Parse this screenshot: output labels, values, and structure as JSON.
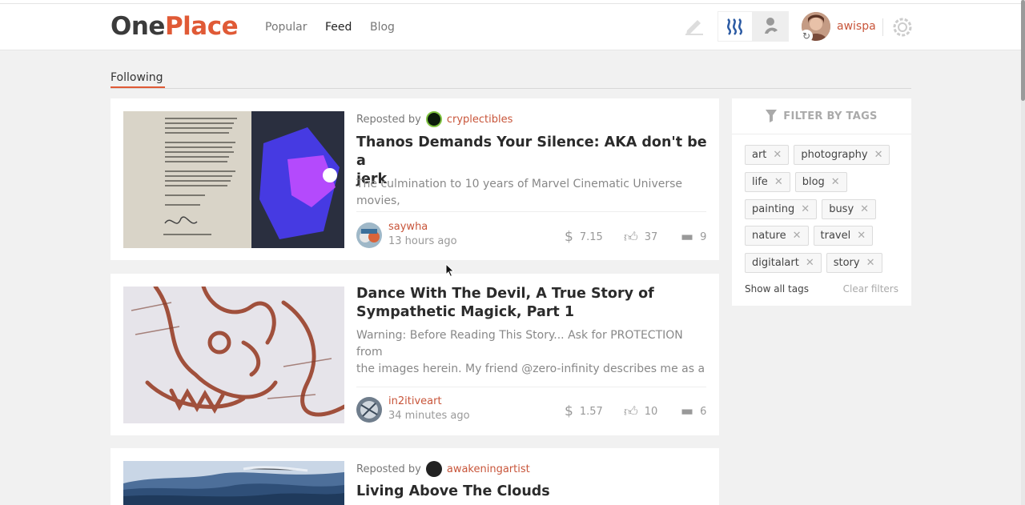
{
  "header": {
    "logo_one": "One",
    "logo_place": "Place",
    "nav": [
      "Popular",
      "Feed",
      "Blog"
    ],
    "active_nav": "Feed",
    "username": "awispa",
    "icons": [
      "pencil-icon",
      "steem-icon",
      "busy-icon",
      "settings-icon"
    ]
  },
  "tabs": {
    "following": "Following"
  },
  "posts": [
    {
      "repost_label": "Reposted by",
      "reposted_by": "cryplectibles",
      "title_line1": "Thanos Demands Your Silence: AKA don't be a",
      "title_line2": "jerk",
      "excerpt_line1": "The culmination to 10 years of Marvel Cinematic Universe movies,",
      "excerpt_line2": "",
      "author": "saywha",
      "time": "13 hours ago",
      "payout": "7.15",
      "votes": "37",
      "comments": "9"
    },
    {
      "title_line1": "Dance With The Devil, A True Story of",
      "title_line2": "Sympathetic Magick, Part 1",
      "excerpt_line1": "Warning: Before Reading This Story... Ask for PROTECTION from",
      "excerpt_line2": "the images herein. My friend @zero-infinity describes me as a",
      "author": "in2itiveart",
      "time": "34 minutes ago",
      "payout": "1.57",
      "votes": "10",
      "comments": "6"
    },
    {
      "repost_label": "Reposted by",
      "reposted_by": "awakeningartist",
      "title_line1": "Living Above The Clouds"
    }
  ],
  "filter": {
    "title": "FILTER BY TAGS",
    "tags": [
      "art",
      "photography",
      "life",
      "blog",
      "painting",
      "busy",
      "nature",
      "travel",
      "digitalart",
      "story"
    ],
    "show_all": "Show all tags",
    "clear": "Clear filters"
  },
  "colors": {
    "accent": "#e05a36",
    "link": "#c8553a",
    "bg": "#f1f1f1"
  }
}
